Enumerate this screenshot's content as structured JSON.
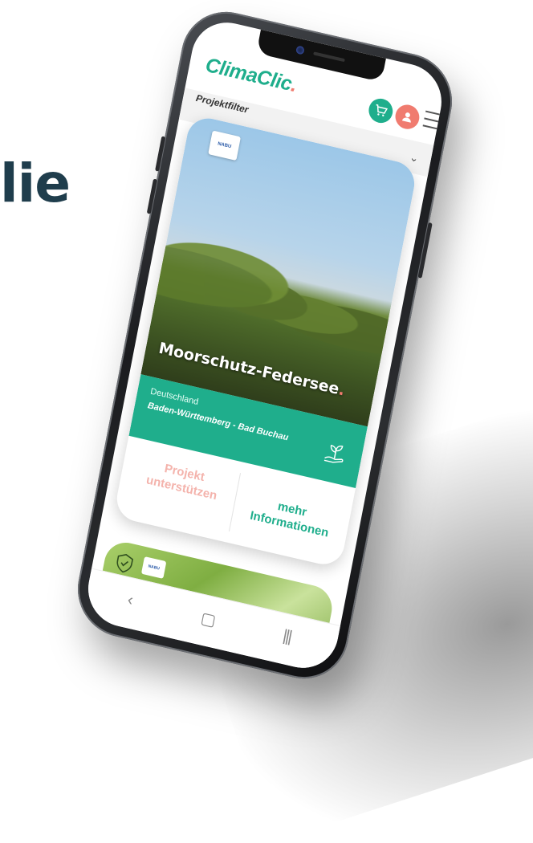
{
  "headline": "lie",
  "app": {
    "logo_text": "ClimaClic",
    "logo_dot": "."
  },
  "filter": {
    "label": "Projektfilter"
  },
  "card": {
    "org_logo_text": "NABU",
    "title": "Moorschutz-Federsee",
    "title_dot": ".",
    "country": "Deutschland",
    "region": "Baden-Württemberg - Bad Buchau",
    "support_label": "Projekt unterstützen",
    "info_label": "mehr Informationen"
  },
  "card2": {
    "org_logo_text": "NABU"
  },
  "navbar": {
    "back_icon": "‹",
    "home_icon": "▢",
    "recent_icon": "|||"
  },
  "colors": {
    "brand_green": "#1fae8c",
    "brand_coral": "#f07b6f",
    "headline": "#1f3d4c"
  },
  "icons": {
    "cart": "cart-icon",
    "user": "user-icon",
    "menu": "menu-icon",
    "chevron": "chevron-down-icon",
    "plant": "plant-hand-icon",
    "shield": "shield-icon"
  }
}
